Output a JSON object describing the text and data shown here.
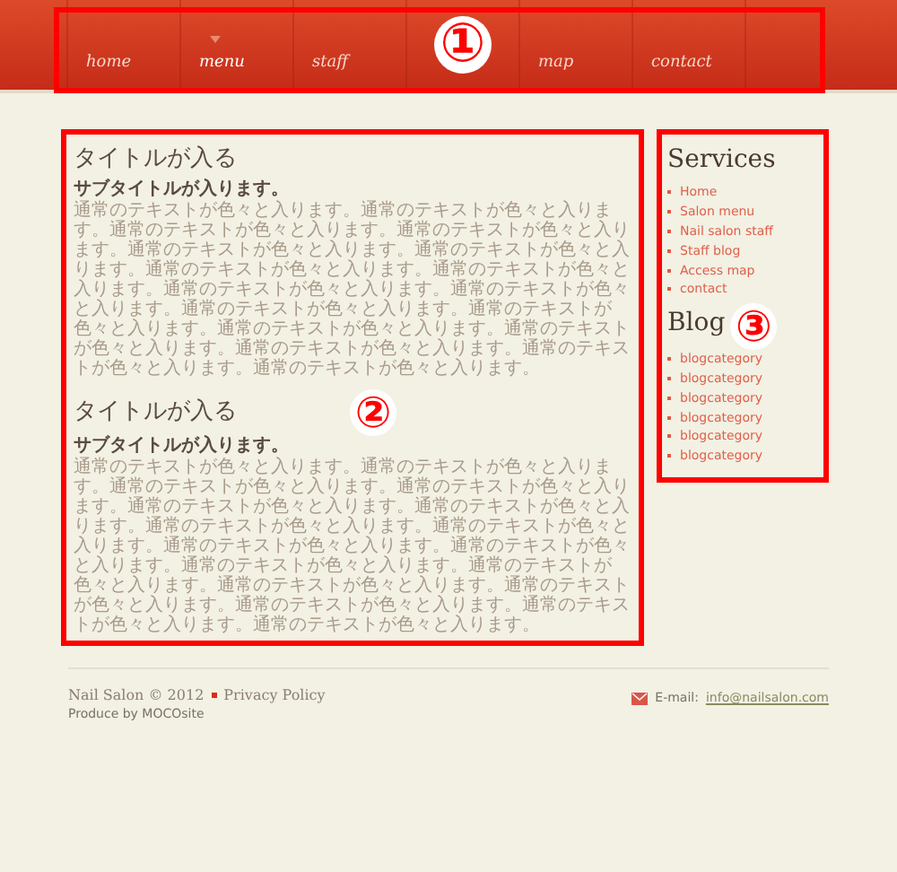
{
  "nav": [
    {
      "label": "home",
      "selected": false
    },
    {
      "label": "menu",
      "selected": true
    },
    {
      "label": "staff",
      "selected": false
    },
    {
      "label": "map",
      "selected": false
    },
    {
      "label": "contact",
      "selected": false
    }
  ],
  "annotations": [
    {
      "label": "①"
    },
    {
      "label": "②"
    },
    {
      "label": "③"
    }
  ],
  "sections": [
    {
      "title": "タイトルが入る",
      "subtitle": "サブタイトルが入ります。",
      "body": "通常のテキストが色々と入ります。通常のテキストが色々と入ります。通常のテキストが色々と入ります。通常のテキストが色々と入ります。通常のテキストが色々と入ります。通常のテキストが色々と入ります。通常のテキストが色々と入ります。通常のテキストが色々と入ります。通常のテキストが色々と入ります。通常のテキストが色々と入ります。通常のテキストが色々と入ります。通常のテキストが色々と入ります。通常のテキストが色々と入ります。通常のテキストが色々と入ります。通常のテキストが色々と入ります。通常のテキストが色々と入ります。通常のテキストが色々と入ります。"
    },
    {
      "title": "タイトルが入る",
      "subtitle": "サブタイトルが入ります。",
      "body": "通常のテキストが色々と入ります。通常のテキストが色々と入ります。通常のテキストが色々と入ります。通常のテキストが色々と入ります。通常のテキストが色々と入ります。通常のテキストが色々と入ります。通常のテキストが色々と入ります。通常のテキストが色々と入ります。通常のテキストが色々と入ります。通常のテキストが色々と入ります。通常のテキストが色々と入ります。通常のテキストが色々と入ります。通常のテキストが色々と入ります。通常のテキストが色々と入ります。通常のテキストが色々と入ります。通常のテキストが色々と入ります。通常のテキストが色々と入ります。"
    }
  ],
  "sidebar": [
    {
      "heading": "Services",
      "items": [
        "Home",
        "Salon menu",
        "Nail salon staff",
        "Staff blog",
        "Access map",
        "contact"
      ]
    },
    {
      "heading": "Blog",
      "items": [
        "blogcategory",
        "blogcategory",
        "blogcategory",
        "blogcategory",
        "blogcategory",
        "blogcategory"
      ]
    }
  ],
  "footer": {
    "copyright": "Nail Salon © 2012",
    "privacy": "Privacy Policy",
    "credit": "Produce by MOCOsite",
    "email_label": "E-mail:",
    "email": "info@nailsalon.com"
  }
}
